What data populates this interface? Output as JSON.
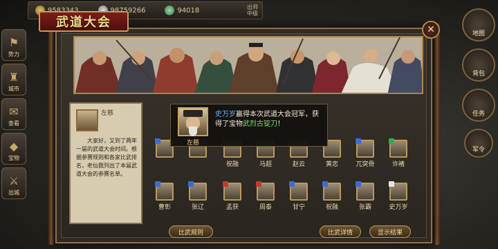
{
  "resources": [
    {
      "icon": "gold-coin-icon",
      "value": "9583343"
    },
    {
      "icon": "silver-ingot-icon",
      "value": "98759266"
    },
    {
      "icon": "jade-icon",
      "value": "94018"
    }
  ],
  "server": {
    "line1": "出师",
    "line2": "中级"
  },
  "left_menu": [
    "势力",
    "城市",
    "查看",
    "宝物",
    "出城"
  ],
  "right_menu": [
    "地图",
    "背包",
    "任务",
    "军令"
  ],
  "panel": {
    "title": "武道大会"
  },
  "description": {
    "name": "左慈",
    "text": "大家好，又到了两年一届的武道大会时间。根据参赛规则和各家比武排名，老仙我列出了本届武道大会的参赛名单。"
  },
  "popup": {
    "hero_name": "左慈",
    "player": "史万岁",
    "msg_mid": "赢得本次武道大会冠军，获得了宝物",
    "item": "武烈古锭刀",
    "msg_end": "！"
  },
  "heroes_row1": [
    {
      "name": "",
      "pip": "#3d6bd8"
    },
    {
      "name": "",
      "pip": "#3ba55a"
    },
    {
      "name": "祝融",
      "pip": "#3ba55a"
    },
    {
      "name": "马超",
      "pip": "#3ba55a"
    },
    {
      "name": "赵云",
      "pip": "#3ba55a"
    },
    {
      "name": "黄忠",
      "pip": "#3d6bd8"
    },
    {
      "name": "兀突骨",
      "pip": "#3d6bd8"
    },
    {
      "name": "许褚",
      "pip": "#3ba55a"
    }
  ],
  "heroes_row2": [
    {
      "name": "曹彰",
      "pip": "#3d6bd8"
    },
    {
      "name": "张辽",
      "pip": "#3d6bd8"
    },
    {
      "name": "孟获",
      "pip": "#c23a2a"
    },
    {
      "name": "周泰",
      "pip": "#c23a2a"
    },
    {
      "name": "甘宁",
      "pip": "#3d6bd8"
    },
    {
      "name": "祝融",
      "pip": "#3d6bd8"
    },
    {
      "name": "张霸",
      "pip": "#3d6bd8"
    },
    {
      "name": "史万岁",
      "pip": "#e6e6e6"
    }
  ],
  "buttons": {
    "rules": "比武规则",
    "details": "比武详情",
    "results": "显示结果"
  }
}
